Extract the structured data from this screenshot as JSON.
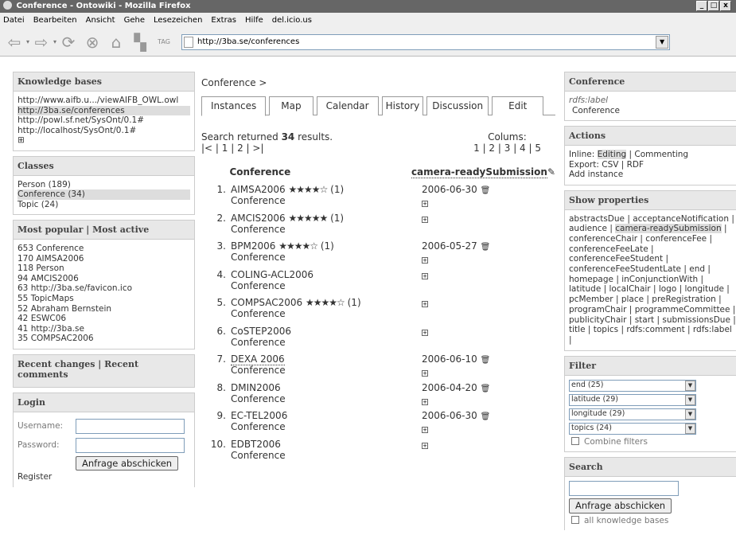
{
  "window": {
    "title": "Conference - Ontowiki - Mozilla Firefox",
    "min": "_",
    "max": "□",
    "close": "x"
  },
  "menu": [
    "Datei",
    "Bearbeiten",
    "Ansicht",
    "Gehe",
    "Lesezeichen",
    "Extras",
    "Hilfe",
    "del.icio.us"
  ],
  "nav": {
    "url": "http://3ba.se/conferences",
    "tag": "TAG"
  },
  "knowledge_bases": {
    "title": "Knowledge bases",
    "items": [
      "http://www.aifb.u.../viewAIFB_OWL.owl",
      "http://3ba.se/conferences",
      "http://powl.sf.net/SysOnt/0.1#",
      "http://localhost/SysOnt/0.1#"
    ],
    "more": "⊞"
  },
  "classes": {
    "title": "Classes",
    "items": [
      "Person (189)",
      "Conference (34)",
      "Topic (24)"
    ]
  },
  "popular": {
    "title": "Most popular | Most active",
    "items": [
      "653 Conference",
      "170 AIMSA2006",
      "118 Person",
      "94 AMCIS2006",
      "63 http://3ba.se/favicon.ico",
      "55 TopicMaps",
      "52 Abraham Bernstein",
      "42 ESWC06",
      "41 http://3ba.se",
      "35 COMPSAC2006"
    ]
  },
  "recent": {
    "title": "Recent changes | Recent comments"
  },
  "login": {
    "title": "Login",
    "username_label": "Username:",
    "password_label": "Password:",
    "submit": "Anfrage abschicken",
    "register": "Register"
  },
  "breadcrumb": "Conference >",
  "tabs": [
    "Instances",
    "Map",
    "Calendar",
    "History",
    "Discussion",
    "Edit"
  ],
  "results": {
    "prefix": "Search returned",
    "count": "34",
    "suffix": "results.",
    "pager": "|< | 1 | 2 | >|",
    "columns_label": "Colums:",
    "columns_pager": "1 | 2 | 3 | 4 | 5"
  },
  "table": {
    "col1": "Conference",
    "col2": "camera-readySubmission",
    "rows": [
      {
        "n": "1.",
        "name": "AIMSA2006",
        "stars": "★★★★☆",
        "rating": "(1)",
        "type": "Conference",
        "date": "2006-06-30"
      },
      {
        "n": "2.",
        "name": "AMCIS2006",
        "stars": "★★★★★",
        "rating": "(1)",
        "type": "Conference",
        "date": ""
      },
      {
        "n": "3.",
        "name": "BPM2006",
        "stars": "★★★★☆",
        "rating": "(1)",
        "type": "Conference",
        "date": "2006-05-27"
      },
      {
        "n": "4.",
        "name": "COLING-ACL2006",
        "stars": "",
        "rating": "",
        "type": "Conference",
        "date": ""
      },
      {
        "n": "5.",
        "name": "COMPSAC2006",
        "stars": "★★★★☆",
        "rating": "(1)",
        "type": "Conference",
        "date": ""
      },
      {
        "n": "6.",
        "name": "CoSTEP2006",
        "stars": "",
        "rating": "",
        "type": "Conference",
        "date": ""
      },
      {
        "n": "7.",
        "name": "DEXA 2006",
        "stars": "",
        "rating": "",
        "type": "Conference",
        "date": "2006-06-10"
      },
      {
        "n": "8.",
        "name": "DMIN2006",
        "stars": "",
        "rating": "",
        "type": "Conference",
        "date": "2006-04-20"
      },
      {
        "n": "9.",
        "name": "EC-TEL2006",
        "stars": "",
        "rating": "",
        "type": "Conference",
        "date": "2006-06-30"
      },
      {
        "n": "10.",
        "name": "EDBT2006",
        "stars": "",
        "rating": "",
        "type": "Conference",
        "date": ""
      }
    ]
  },
  "conference_box": {
    "title": "Conference",
    "label_key": "rdfs:label",
    "label_val": "Conference"
  },
  "actions": {
    "title": "Actions",
    "inline": "Inline:",
    "editing": "Editing",
    "commenting": "| Commenting",
    "export": "Export: CSV | RDF",
    "add": "Add instance"
  },
  "show_props": {
    "title": "Show properties",
    "pre": "abstractsDue | acceptanceNotification | audience |",
    "hl": "camera-readySubmission",
    "post": "| conferenceChair | conferenceFee | conferenceFeeLate | conferenceFeeStudent | conferenceFeeStudentLate | end | homepage | inConjunctionWith | latitude | localChair | logo | longitude | pcMember | place | preRegistration | programChair | programmeCommittee | publicityChair | start | submissionsDue | title | topics | rdfs:comment | rdfs:label |"
  },
  "filter": {
    "title": "Filter",
    "selects": [
      "end (25)",
      "latitude (29)",
      "longitude (29)",
      "topics (24)"
    ],
    "combine": "Combine filters"
  },
  "search": {
    "title": "Search",
    "submit": "Anfrage abschicken",
    "all_kb": "all knowledge bases"
  }
}
